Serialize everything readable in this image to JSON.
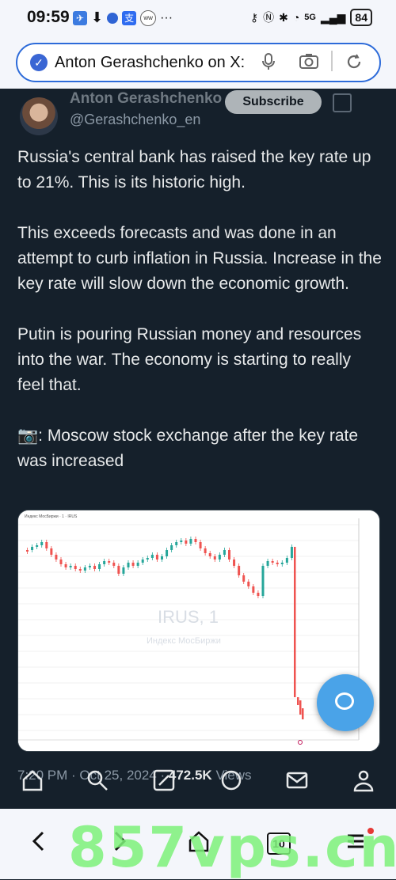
{
  "status_bar": {
    "time": "09:59",
    "network": "5G",
    "battery": "84"
  },
  "url_bar": {
    "text": "Anton Gerashchenko on X:"
  },
  "post": {
    "author_name": "Anton Gerashchenko",
    "handle": "@Gerashchenko_en",
    "subscribe_label": "Subscribe",
    "paragraphs": [
      "Russia's central bank has raised the key rate up to 21%. This is its historic high.",
      "This exceeds forecasts and was done in an attempt to curb inflation in Russia. Increase in the key rate will slow down the economic growth.",
      "Putin is pouring Russian money and resources into the war. The economy is starting to really feel that.",
      "📷: Moscow stock exchange after the key rate was increased"
    ],
    "meta": {
      "time": "7:20 PM",
      "date": "Oct 25, 2024",
      "views_count": "472.5K",
      "views_label": "Views"
    }
  },
  "chart": {
    "watermark_ticker": "IRUS, 1",
    "watermark_subtitle": "Индекс МосБиржи",
    "header": "Индекс МосБиржи · 1 · IRUS"
  },
  "navbar": {
    "tabs_count": "10"
  },
  "watermark": "857vps.cn",
  "colors": {
    "accent": "#4aa3e8",
    "bg": "#15202b",
    "candle_up": "#26a69a",
    "candle_down": "#ef5350"
  }
}
